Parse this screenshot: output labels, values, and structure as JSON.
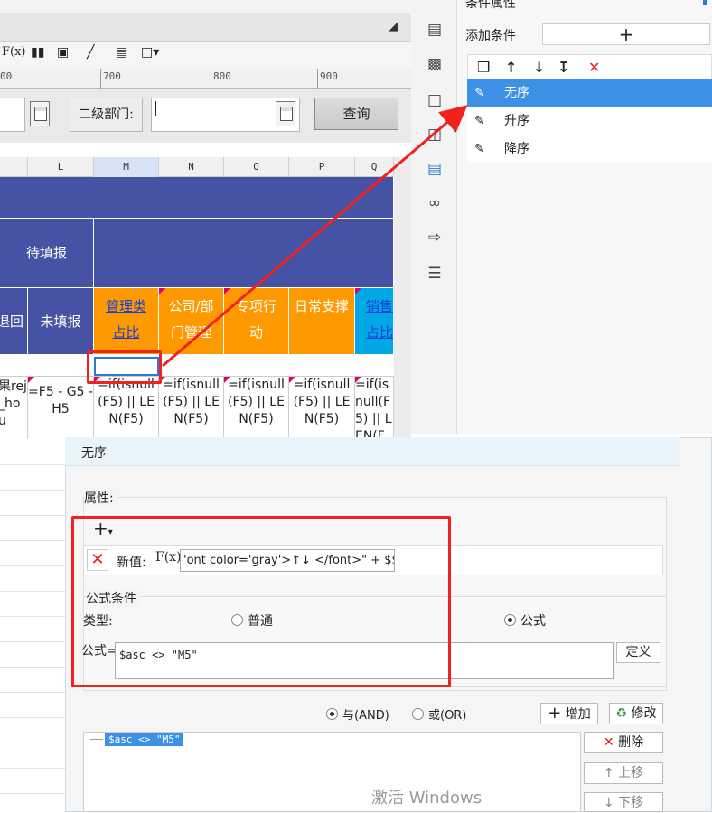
{
  "right_panel": {
    "title": "条件属性",
    "add_condition_label": "添加条件",
    "add_condition_button": "+",
    "conditions": [
      {
        "label": "无序",
        "selected": true
      },
      {
        "label": "升序",
        "selected": false
      },
      {
        "label": "降序",
        "selected": false
      }
    ]
  },
  "toolbar": {
    "fx_label": "F(x)"
  },
  "ruler": {
    "ticks": [
      "00",
      "700",
      "800",
      "900"
    ]
  },
  "param_panel": {
    "level2_dept_label": "二级部门:",
    "query_button": "查询"
  },
  "sheet": {
    "columns": [
      "L",
      "M",
      "N",
      "O",
      "P",
      "Q"
    ],
    "header_pending": "待填报",
    "col_returned": "退回",
    "col_unfilled": "未填报",
    "col_mgmt_ratio": "管理类占比",
    "col_company_dept": "公司/部门管理",
    "col_special": "专项行动",
    "col_daily": "日常支撑",
    "col_sales": "销售占比",
    "formula_left": "果rej_hou",
    "formula_l": "=F5 - G5 - H5",
    "formula_generic": "=if(isnull(F5) || LEN(F5)"
  },
  "dialog": {
    "title": "无序",
    "property_label": "属性:",
    "new_value_label": "新值:",
    "fx_label": "F(x)",
    "new_value_text": "'ont color='gray'>↑↓ </font>\" + $$$",
    "formula_condition_label": "公式条件",
    "type_label": "类型:",
    "type_normal": "普通",
    "type_formula": "公式",
    "type_selected": "公式",
    "formula_label": "公式=",
    "formula_value": "$asc <> \"M5\"",
    "define_button": "定义",
    "and_label": "与(AND)",
    "or_label": "或(OR)",
    "logic_selected": "与(AND)",
    "add_button": "增加",
    "modify_button": "修改",
    "list_item": "$asc <> \"M5\"",
    "delete_button": "删除",
    "up_button": "上移",
    "down_button": "下移"
  },
  "watermark": "激活 Windows",
  "colors": {
    "selection_blue": "#3c90e5",
    "header_indigo": "#4652a3",
    "orange": "#ff9900",
    "cyan": "#00a9e6",
    "annotation_red": "#f0211f"
  }
}
